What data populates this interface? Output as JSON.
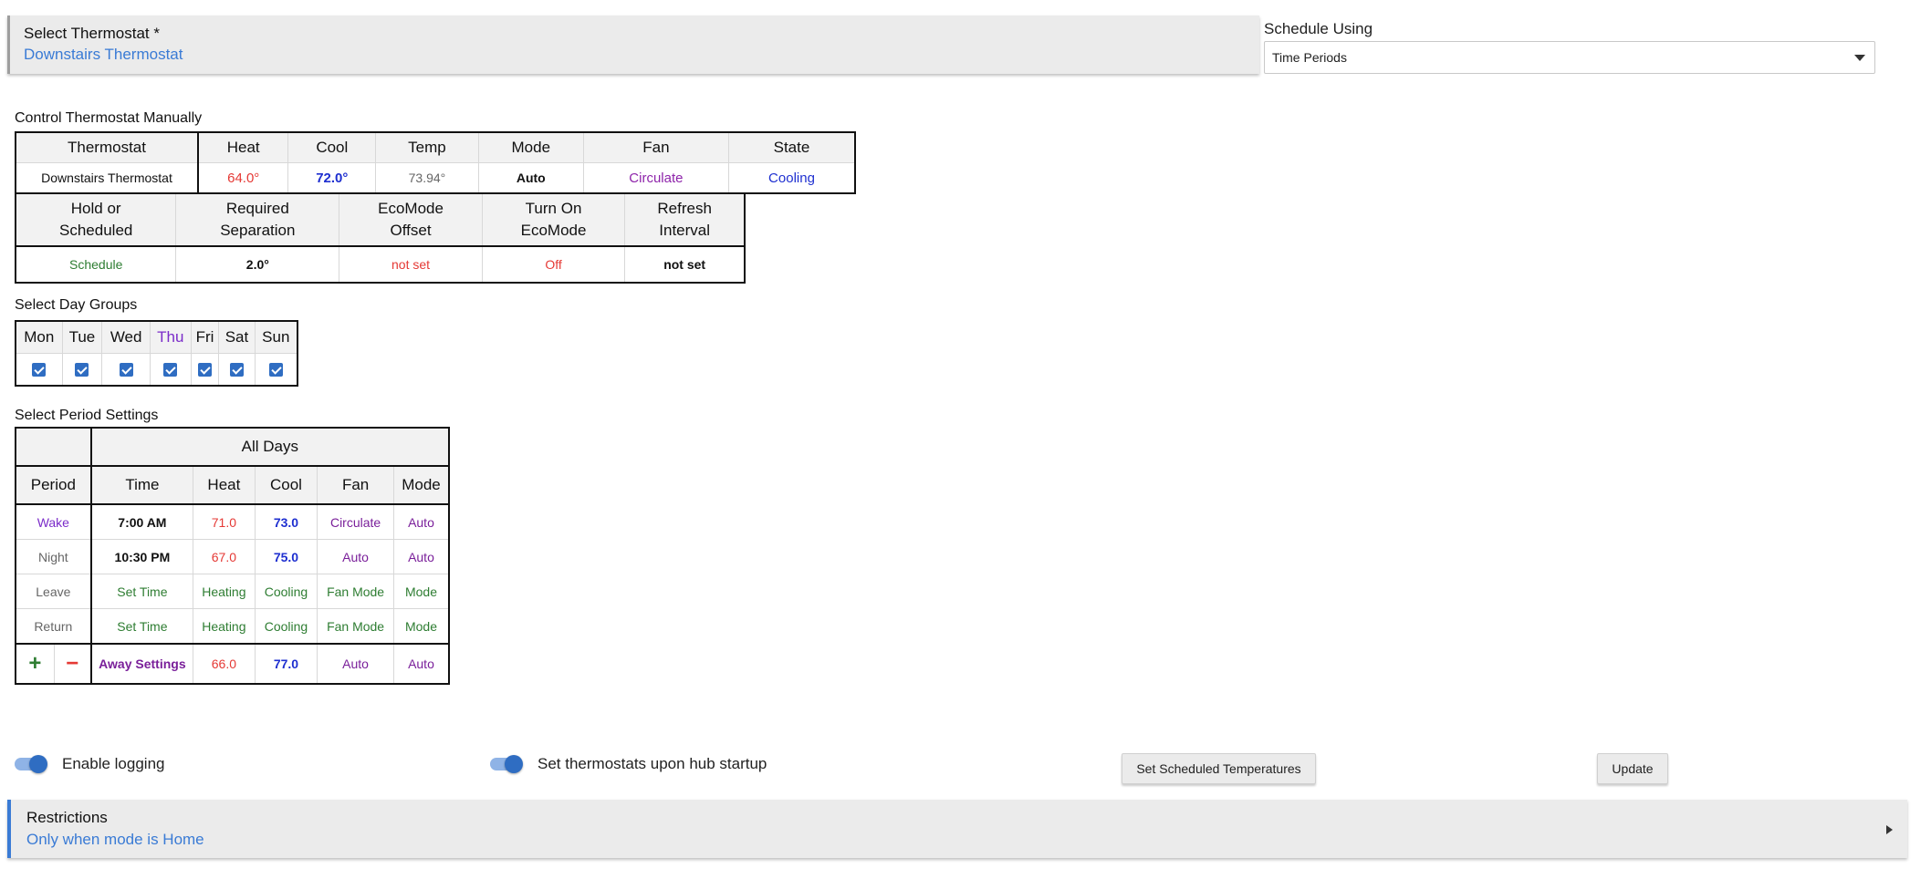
{
  "thermostat_select": {
    "label": "Select Thermostat *",
    "value": "Downstairs Thermostat"
  },
  "schedule_using": {
    "label": "Schedule Using",
    "value": "Time Periods"
  },
  "manual": {
    "title": "Control Thermostat Manually",
    "headers": [
      "Thermostat",
      "Heat",
      "Cool",
      "Temp",
      "Mode",
      "Fan",
      "State"
    ],
    "values": [
      "Downstairs Thermostat",
      "64.0°",
      "72.0°",
      "73.94°",
      "Auto",
      "Circulate",
      "Cooling"
    ],
    "headers2": [
      "Hold or\nScheduled",
      "Required\nSeparation",
      "EcoMode\nOffset",
      "Turn On\nEcoMode",
      "Refresh\nInterval"
    ],
    "values2": [
      "Schedule",
      "2.0°",
      "not set",
      "Off",
      "not set"
    ]
  },
  "day_groups": {
    "title": "Select Day Groups",
    "days": [
      "Mon",
      "Tue",
      "Wed",
      "Thu",
      "Fri",
      "Sat",
      "Sun"
    ],
    "checked": [
      true,
      true,
      true,
      true,
      true,
      true,
      true
    ],
    "highlight_color": "#7b2cc9"
  },
  "periods": {
    "title": "Select Period Settings",
    "group_header": "All Days",
    "headers": [
      "Period",
      "Time",
      "Heat",
      "Cool",
      "Fan",
      "Mode"
    ],
    "rows": [
      [
        "Wake",
        "7:00 AM",
        "71.0",
        "73.0",
        "Circulate",
        "Auto"
      ],
      [
        "Night",
        "10:30 PM",
        "67.0",
        "75.0",
        "Auto",
        "Auto"
      ],
      [
        "Leave",
        "Set Time",
        "Heating",
        "Cooling",
        "Fan Mode",
        "Mode"
      ],
      [
        "Return",
        "Set Time",
        "Heating",
        "Cooling",
        "Fan Mode",
        "Mode"
      ]
    ],
    "add_symbol": "+",
    "remove_symbol": "−",
    "away": [
      "Away Settings",
      "66.0",
      "77.0",
      "Auto",
      "Auto"
    ]
  },
  "toggles": {
    "logging": {
      "label": "Enable logging",
      "on": true
    },
    "startup": {
      "label": "Set thermostats upon hub startup",
      "on": true
    }
  },
  "buttons": {
    "set_scheduled": "Set Scheduled Temperatures",
    "update": "Update"
  },
  "restrictions": {
    "label": "Restrictions",
    "value": "Only when mode is Home"
  },
  "colors": {
    "accent": "#3a7bd5",
    "heat": "#e53935",
    "cool": "#1e2fd0",
    "purple": "#8e24aa",
    "green": "#2e7d32"
  }
}
